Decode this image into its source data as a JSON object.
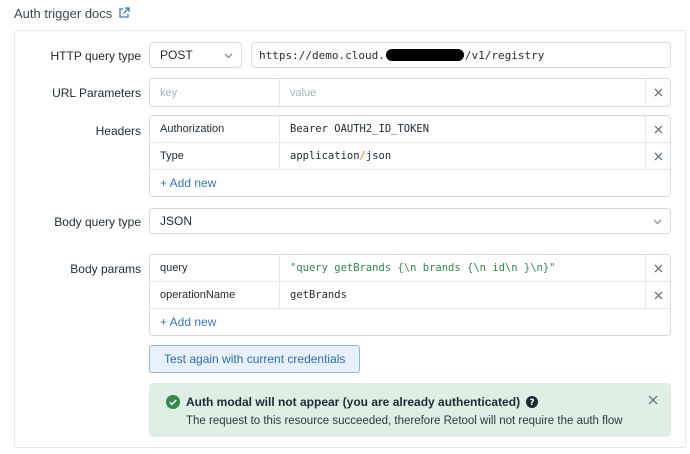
{
  "header": {
    "title": "Auth trigger docs",
    "link_icon": "external-link-icon"
  },
  "form": {
    "http_query_type": {
      "label": "HTTP query type",
      "method": "POST",
      "url_prefix": "https://demo.cloud.",
      "url_suffix": "/v1/registry"
    },
    "url_parameters": {
      "label": "URL Parameters",
      "key_placeholder": "key",
      "value_placeholder": "value"
    },
    "headers": {
      "label": "Headers",
      "rows": [
        {
          "key": "Authorization",
          "value": "Bearer OAUTH2_ID_TOKEN"
        },
        {
          "key": "Type",
          "value_a": "application",
          "value_sep": "/",
          "value_b": "json"
        }
      ],
      "add_new": "+ Add new"
    },
    "body_query_type": {
      "label": "Body query type",
      "value": "JSON"
    },
    "body_params": {
      "label": "Body params",
      "rows": [
        {
          "key": "query",
          "value": "\"query getBrands {\\n  brands {\\n    id\\n  }\\n}\""
        },
        {
          "key": "operationName",
          "value": "getBrands"
        }
      ],
      "add_new": "+ Add new"
    },
    "test_button": "Test again with current credentials"
  },
  "alert": {
    "title": "Auth modal will not appear (you are already authenticated)",
    "body": "The request to this resource succeeded, therefore Retool will not require the auth flow",
    "accent_color": "#2f8a4a",
    "background_color": "#e0efe5"
  }
}
